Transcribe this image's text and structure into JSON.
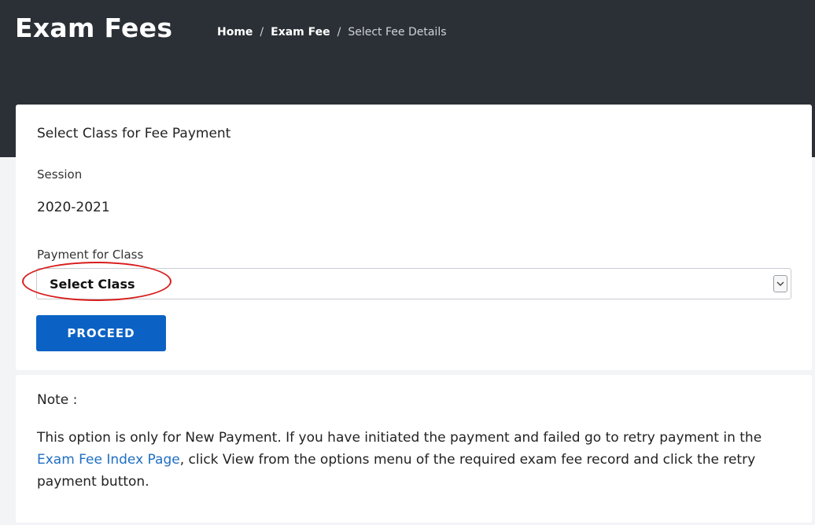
{
  "header": {
    "title": "Exam Fees",
    "breadcrumb": {
      "home": "Home",
      "exam_fee": "Exam Fee",
      "current": "Select Fee Details",
      "separator": "/"
    }
  },
  "form": {
    "heading": "Select Class for Fee Payment",
    "session_label": "Session",
    "session_value": "2020-2021",
    "class_label": "Payment for Class",
    "class_select_value": "Select Class",
    "proceed_label": "PROCEED"
  },
  "note": {
    "heading": "Note :",
    "text_before": "This option is only for New Payment. If you have initiated the payment and failed go to retry payment in the ",
    "link_text": "Exam Fee Index Page",
    "text_after": ", click View from the options menu of the required exam fee record and click the retry payment button."
  },
  "colors": {
    "header_bg": "#2b3036",
    "button_bg": "#0b62c4",
    "link": "#1f6fc4",
    "annotation": "#d81d1d"
  },
  "icons": {
    "select_arrow": "chevron-down-icon"
  }
}
